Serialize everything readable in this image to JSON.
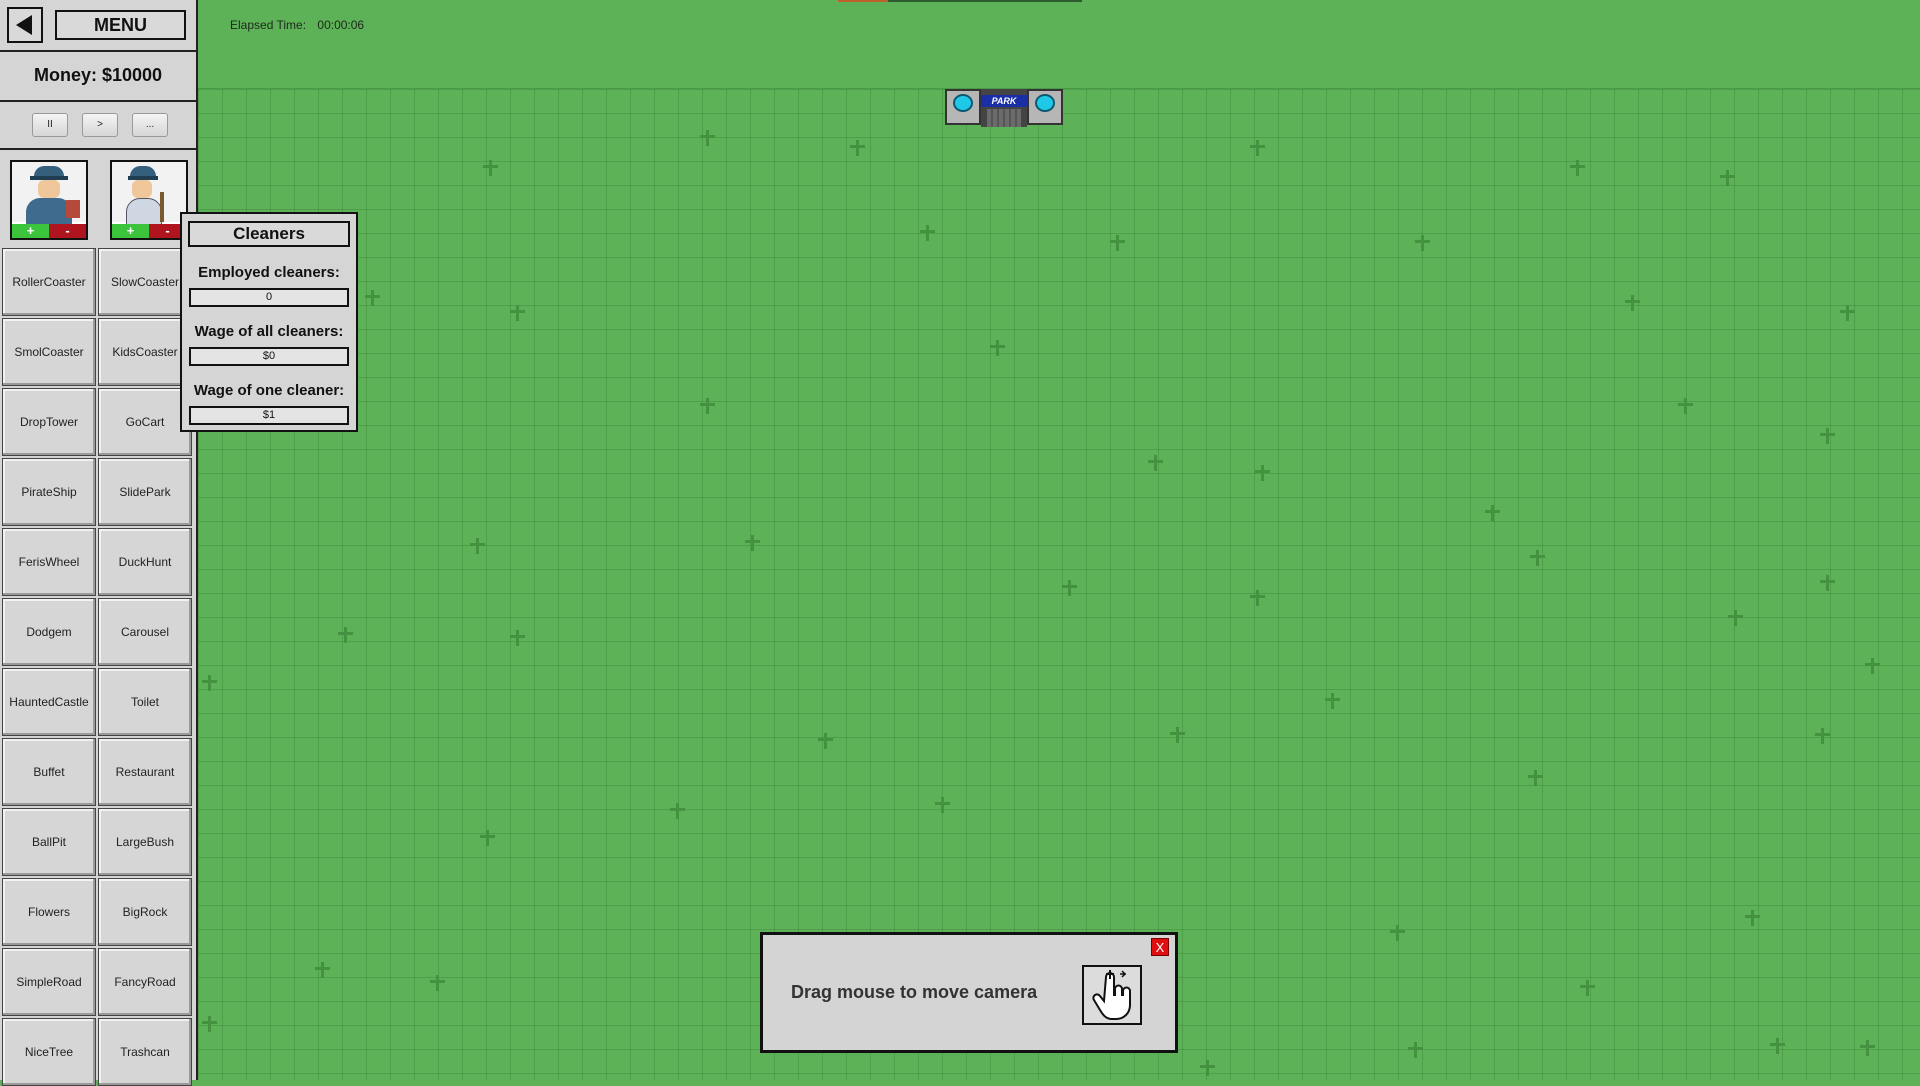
{
  "hud": {
    "elapsed_label": "Elapsed Time:",
    "elapsed_value": "00:00:06"
  },
  "park_gate": {
    "sign": "PARK"
  },
  "sidebar": {
    "menu_label": "MENU",
    "money": "Money: $10000",
    "speed_buttons": [
      "II",
      ">",
      "..."
    ],
    "staff": [
      {
        "icon": "mechanic-icon",
        "plus": "+",
        "minus": "-"
      },
      {
        "icon": "cleaner-icon",
        "plus": "+",
        "minus": "-"
      }
    ],
    "rides": [
      "RollerCoaster",
      "SlowCoaster",
      "SmolCoaster",
      "KidsCoaster",
      "DropTower",
      "GoCart",
      "PirateShip",
      "SlidePark",
      "FerisWheel",
      "DuckHunt",
      "Dodgem",
      "Carousel",
      "HauntedCastle",
      "Toilet",
      "Buffet",
      "Restaurant",
      "BallPit",
      "LargeBush",
      "Flowers",
      "BigRock",
      "SimpleRoad",
      "FancyRoad",
      "NiceTree",
      "Trashcan"
    ]
  },
  "cleaners_panel": {
    "title": "Cleaners",
    "employed_label": "Employed cleaners:",
    "employed_value": "0",
    "wage_all_label": "Wage of all cleaners:",
    "wage_all_value": "$0",
    "wage_one_label": "Wage of one cleaner:",
    "wage_one_value": "$1"
  },
  "tutorial": {
    "text": "Drag mouse to move camera",
    "close_label": "X",
    "icon": "hand-drag-icon"
  },
  "colors": {
    "grass": "#5db157",
    "panel": "#d5d5d5",
    "plus": "#3cc43c",
    "minus": "#b0141e",
    "close": "#e01010"
  }
}
